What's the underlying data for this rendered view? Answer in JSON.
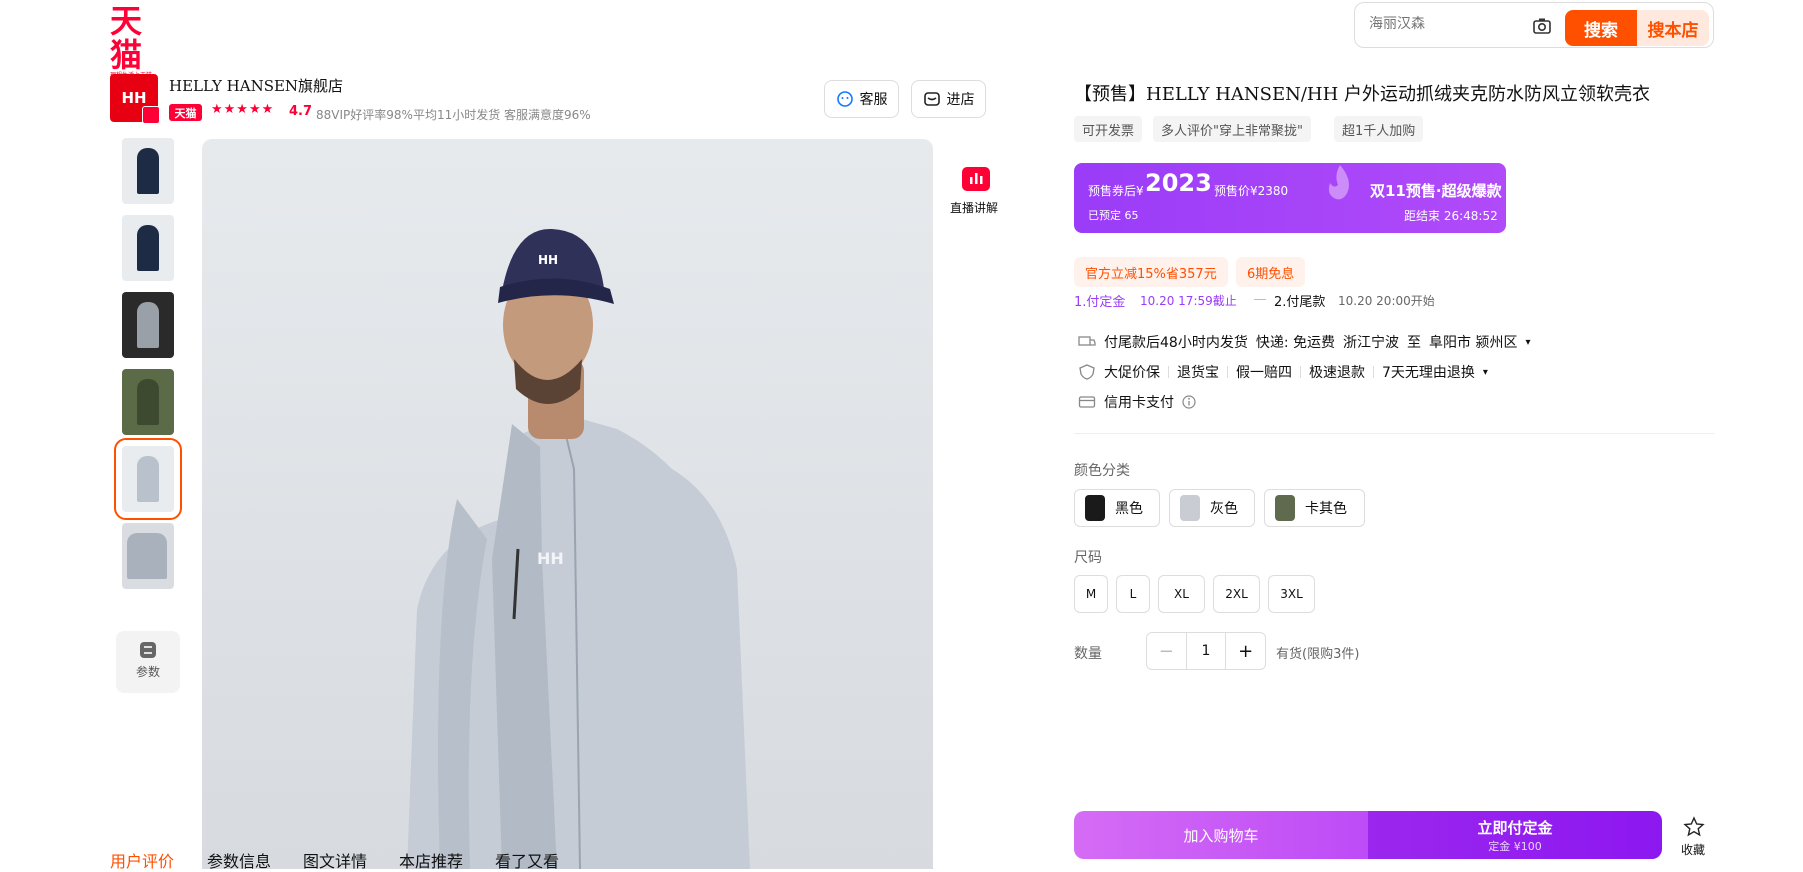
{
  "header": {
    "logo_text": "天猫",
    "logo_slogan": "理想生活上天猫",
    "search_placeholder": "海丽汉森",
    "search_button": "搜索",
    "search_shop_button": "搜本店"
  },
  "shop": {
    "logo_text": "HH",
    "name": "HELLY HANSEN旗舰店",
    "badge": "天猫",
    "stars": "★★★★★",
    "rating": "4.7",
    "stats": [
      "88VIP好评率98%",
      "平均11小时发货",
      "客服满意度96%"
    ],
    "service_button": "客服",
    "enter_shop_button": "进店"
  },
  "gallery": {
    "params_label": "参数",
    "live_label": "直播讲解",
    "cap_logo": "HH",
    "jacket_logo": "HH"
  },
  "product": {
    "title": "【预售】HELLY HANSEN/HH 户外运动抓绒夹克防水防风立领软壳衣",
    "tags": [
      "可开发票",
      "多人评价\"穿上非常聚拢\"",
      "超1千人加购"
    ],
    "presale": {
      "after_coupon_label": "预售券后¥",
      "price": "2023",
      "presale_price": "预售价¥2380",
      "reserved": "已预定 65",
      "event": "双11预售·超级爆款",
      "countdown": "距结束 26:48:52"
    },
    "coupons": [
      "官方立减15%省357元",
      "6期免息"
    ],
    "steps": {
      "step1": "1.付定金",
      "step1_time": "10.20 17:59截止",
      "step2": "2.付尾款",
      "step2_time": "10.20 20:00开始"
    },
    "shipping": {
      "delivery": "付尾款后48小时内发货",
      "express": "快递: 免运费",
      "from": "浙江宁波",
      "to_word": "至",
      "to": "阜阳市 颍州区"
    },
    "guarantees": [
      "大促价保",
      "退货宝",
      "假一赔四",
      "极速退款",
      "7天无理由退换"
    ],
    "payment": "信用卡支付",
    "color_label": "颜色分类",
    "colors": [
      {
        "name": "黑色",
        "swatch": "#1a1a1a"
      },
      {
        "name": "灰色",
        "swatch": "#c9ccd3"
      },
      {
        "name": "卡其色",
        "swatch": "#5f6a4f"
      }
    ],
    "size_label": "尺码",
    "sizes": [
      "M",
      "L",
      "XL",
      "2XL",
      "3XL"
    ],
    "qty_label": "数量",
    "qty_minus": "−",
    "qty_value": "1",
    "qty_plus": "+",
    "stock": "有货(限购3件)",
    "add_cart": "加入购物车",
    "pay_deposit": "立即付定金",
    "deposit_amount": "定金 ¥100",
    "favorite": "收藏"
  },
  "tabs": [
    "用户评价",
    "参数信息",
    "图文详情",
    "本店推荐",
    "看了又看"
  ],
  "colors": {
    "brand": "#ff0036",
    "accent": "#ff5000",
    "presale_purple": "#9a3cf8"
  }
}
